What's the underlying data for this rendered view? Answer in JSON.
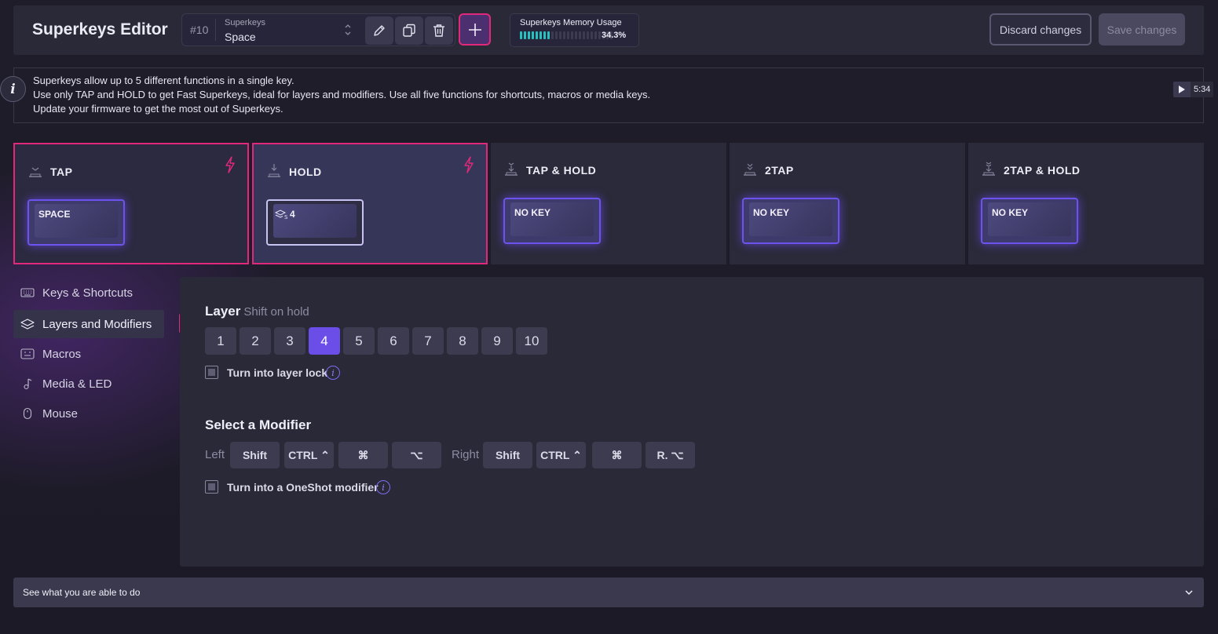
{
  "header": {
    "title": "Superkeys Editor",
    "selector": {
      "number": "#10",
      "label": "Superkeys",
      "value": "Space"
    },
    "memory": {
      "label": "Superkeys Memory Usage",
      "percent_text": "34.3%",
      "percent": 34.3
    },
    "discard_label": "Discard changes",
    "save_label": "Save changes"
  },
  "info": {
    "lines": [
      "Superkeys allow up to 5 different functions in a single key.",
      "Use only TAP and HOLD to get Fast Superkeys, ideal for layers and modifiers. Use all five functions for shortcuts, macros or media keys.",
      "Update your firmware to get the most out of Superkeys."
    ],
    "video_time": "5:34"
  },
  "functions": [
    {
      "title": "TAP",
      "key": "SPACE",
      "icon": "tap-icon",
      "fast": true
    },
    {
      "title": "HOLD",
      "key": "4",
      "key_icon": "layer-shift-icon",
      "icon": "hold-icon",
      "fast": true
    },
    {
      "title": "TAP & HOLD",
      "key": "NO KEY",
      "icon": "tap-hold-icon",
      "fast": false
    },
    {
      "title": "2TAP",
      "key": "NO KEY",
      "icon": "double-tap-icon",
      "fast": false
    },
    {
      "title": "2TAP & HOLD",
      "key": "NO KEY",
      "icon": "double-tap-hold-icon",
      "fast": false
    }
  ],
  "sidebar": {
    "items": [
      {
        "label": "Keys & Shortcuts",
        "icon": "keyboard-icon"
      },
      {
        "label": "Layers and Modifiers",
        "icon": "layers-icon",
        "active": true
      },
      {
        "label": "Macros",
        "icon": "macros-icon"
      },
      {
        "label": "Media & LED",
        "icon": "media-icon"
      },
      {
        "label": "Mouse",
        "icon": "mouse-icon"
      }
    ]
  },
  "layer": {
    "title": "Layer",
    "subtitle": "Shift on hold",
    "options": [
      "1",
      "2",
      "3",
      "4",
      "5",
      "6",
      "7",
      "8",
      "9",
      "10"
    ],
    "selected": "4",
    "lock_label": "Turn into layer lock",
    "info_glyph": "i"
  },
  "modifier": {
    "title": "Select a Modifier",
    "left_label": "Left",
    "right_label": "Right",
    "left": [
      "Shift",
      "CTRL ⌃",
      "⌘",
      "⌥"
    ],
    "right": [
      "Shift",
      "CTRL ⌃",
      "⌘",
      "R. ⌥"
    ],
    "oneshot_label": "Turn into a OneShot modifier"
  },
  "footer": {
    "label": "See what you are able to do"
  },
  "colors": {
    "accent": "#6b4ee8",
    "highlight": "#e2287a",
    "memory": "#27c2bf"
  }
}
